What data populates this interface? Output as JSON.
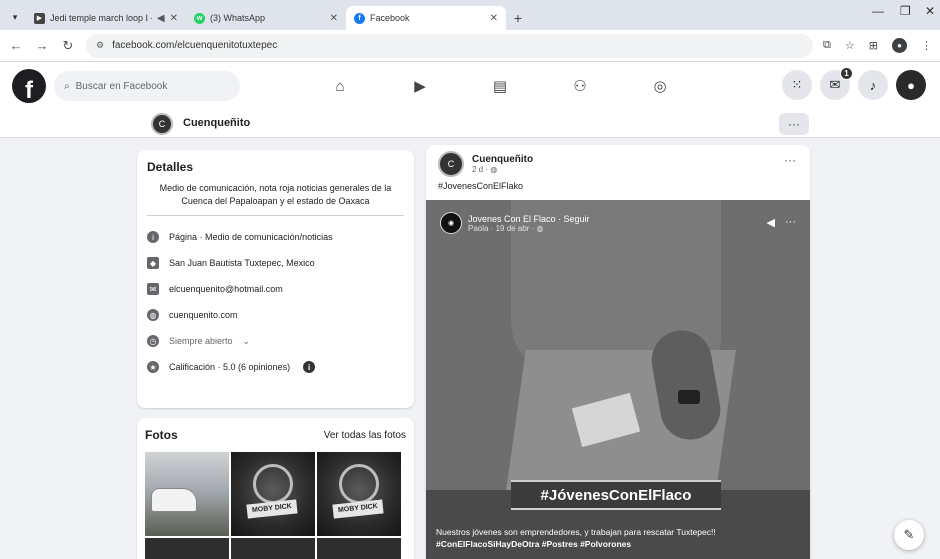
{
  "browser": {
    "tabs": [
      {
        "title": "Jedi temple march loop I - ",
        "active": false
      },
      {
        "title": "(3) WhatsApp",
        "active": false
      },
      {
        "title": "Facebook",
        "active": true
      }
    ],
    "url": "facebook.com/elcuenquenitotuxtepec"
  },
  "fb": {
    "logo": "f",
    "search_placeholder": "Buscar en Facebook",
    "nav_icons": [
      "home-icon",
      "video-icon",
      "marketplace-icon",
      "groups-icon",
      "gaming-icon"
    ],
    "messenger_badge": "1"
  },
  "page": {
    "name": "Cuenqueñito",
    "more": "···"
  },
  "details": {
    "title": "Detalles",
    "bio": "Medio de comunicación, nota roja noticias generales de la Cuenca del Papaloapan y el estado de Oaxaca",
    "rows": [
      {
        "icon": "info-icon",
        "text": "Página · Medio de comunicación/noticias"
      },
      {
        "icon": "location-icon",
        "text": "San Juan Bautista Tuxtepec, Mexico"
      },
      {
        "icon": "email-icon",
        "text": "elcuenquenito@hotmail.com"
      },
      {
        "icon": "globe-icon",
        "text": "cuenquenito.com"
      },
      {
        "icon": "clock-icon",
        "text": "Siempre abierto"
      },
      {
        "icon": "star-icon",
        "text": "Calificación · 5.0 (6 opiniones)"
      }
    ]
  },
  "fotos": {
    "title": "Fotos",
    "see_all": "Ver todas las fotos",
    "stamp": "MOBY DICK"
  },
  "post": {
    "author": "Cuenqueñito",
    "meta": "2 d · ",
    "hashtag": "#JovenesConElFlako",
    "more": "···",
    "video": {
      "channel": "Jovenes Con El Flaco · Seguir",
      "meta": "Paola · 19 de abr · ",
      "banner": "#JóvenesConElFlaco",
      "caption": "Nuestros jóvenes son emprendedores, y trabajan para rescatar Tuxtepec!!",
      "tags": "#ConElFlacoSiHayDeOtra #Postres #Polvorones"
    }
  }
}
